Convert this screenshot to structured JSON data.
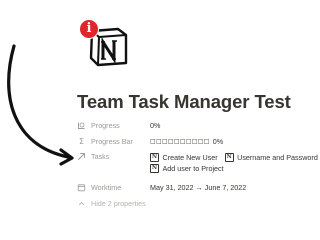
{
  "page": {
    "icon": "notion-logo-icon",
    "badge_icon": "info-icon",
    "badge_text": "i",
    "title": "Team Task Manager Test"
  },
  "annotation": {
    "icon": "curved-arrow-icon",
    "color": "#111111"
  },
  "properties": [
    {
      "icon": "progress-icon",
      "label": "Progress",
      "value": "0%"
    },
    {
      "icon": "sigma-icon",
      "label": "Progress Bar",
      "boxes": "□□□□□□□□□□",
      "value": "0%"
    },
    {
      "icon": "relation-arrow-icon",
      "label": "Tasks",
      "tasks": [
        "Create New User",
        "Username and Password",
        "Add user to Project"
      ]
    },
    {
      "icon": "calendar-icon",
      "label": "Worktime",
      "value": "May 31, 2022 → June 7, 2022"
    }
  ],
  "hide_properties": {
    "icon": "chevron-up-icon",
    "label": "Hide 2 properties"
  },
  "colors": {
    "text": "#37352f",
    "label": "#9b9a97",
    "badge": "#e0262b"
  }
}
